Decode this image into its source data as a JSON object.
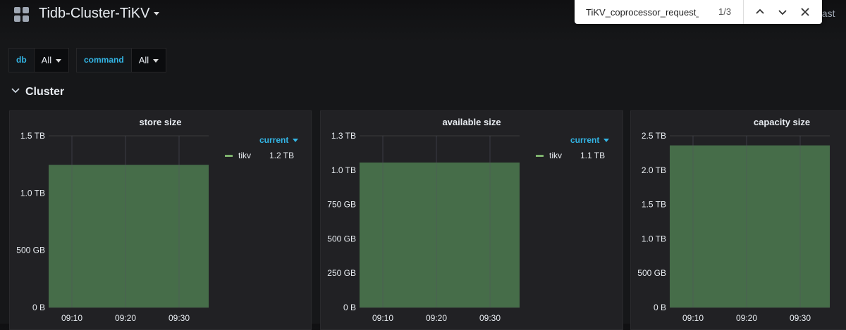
{
  "header": {
    "title": "Tidb-Cluster-TiKV",
    "time_picker_partial": "Last"
  },
  "find_bar": {
    "query": "TiKV_coprocessor_request_erro",
    "count": "1/3"
  },
  "variables": [
    {
      "label": "db",
      "value": "All"
    },
    {
      "label": "command",
      "value": "All"
    }
  ],
  "row": {
    "title": "Cluster"
  },
  "colors": {
    "series": "#7eb26d",
    "fill": "#466d49",
    "accent": "#33b5e5"
  },
  "panels": [
    {
      "title": "store size",
      "legend_header": "current",
      "legend": [
        {
          "name": "tikv",
          "value": "1.2 TB"
        }
      ]
    },
    {
      "title": "available size",
      "legend_header": "current",
      "legend": [
        {
          "name": "tikv",
          "value": "1.1 TB"
        }
      ]
    },
    {
      "title": "capacity size"
    }
  ],
  "chart_data": [
    {
      "type": "area",
      "title": "store size",
      "x": [
        "09:10",
        "09:20",
        "09:30"
      ],
      "y_ticks": [
        "0 B",
        "500 GB",
        "1.0 TB",
        "1.5 TB"
      ],
      "ylim": [
        0,
        1.5
      ],
      "y_unit": "TB",
      "series": [
        {
          "name": "tikv",
          "values": [
            1.24,
            1.24,
            1.24
          ]
        }
      ]
    },
    {
      "type": "area",
      "title": "available size",
      "x": [
        "09:10",
        "09:20",
        "09:30"
      ],
      "y_ticks": [
        "0 B",
        "250 GB",
        "500 GB",
        "750 GB",
        "1.0 TB",
        "1.3 TB"
      ],
      "ylim": [
        0,
        1.25
      ],
      "y_unit": "TB",
      "series": [
        {
          "name": "tikv",
          "values": [
            1.05,
            1.05,
            1.05
          ]
        }
      ]
    },
    {
      "type": "area",
      "title": "capacity size",
      "x": [
        "09:10",
        "09:20",
        "09:30"
      ],
      "y_ticks": [
        "0 B",
        "500 GB",
        "1.0 TB",
        "1.5 TB",
        "2.0 TB",
        "2.5 TB"
      ],
      "ylim": [
        0,
        2.5
      ],
      "y_unit": "TB",
      "series": [
        {
          "values": [
            2.35,
            2.35,
            2.35
          ]
        }
      ]
    }
  ]
}
